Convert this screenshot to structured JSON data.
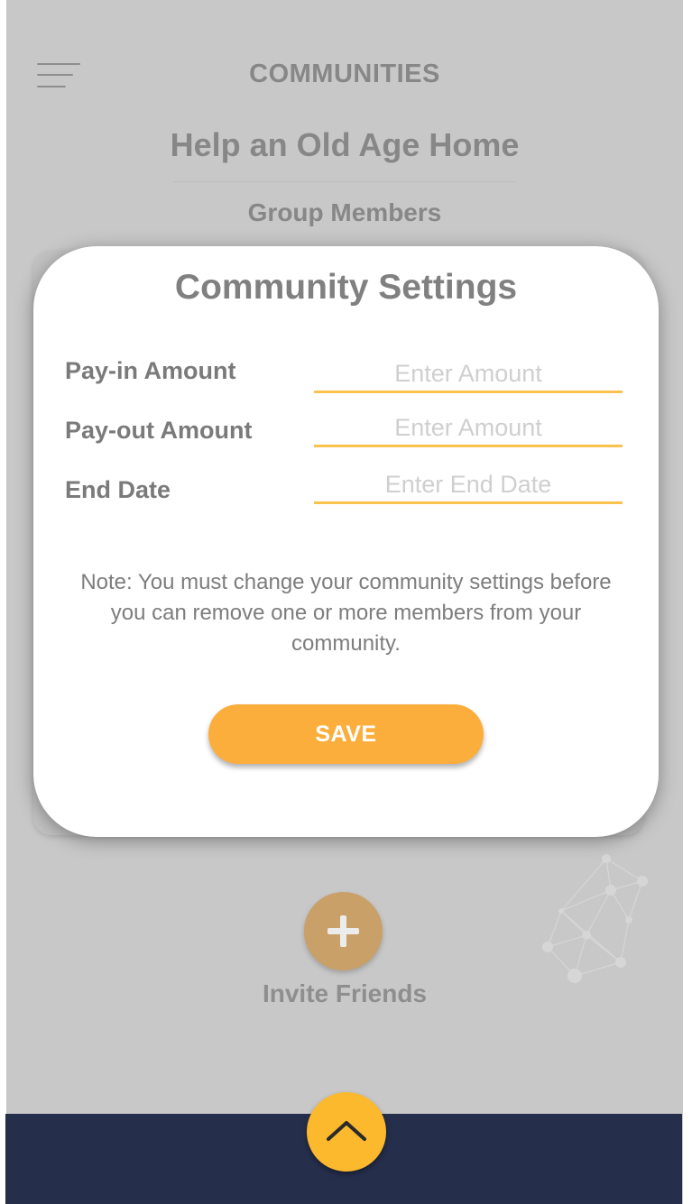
{
  "header": {
    "title": "COMMUNITIES",
    "community_name": "Help an Old Age Home",
    "section_label": "Group Members",
    "menu_icon": "hamburger-menu-icon"
  },
  "modal": {
    "title": "Community Settings",
    "fields": [
      {
        "label": "Pay-in Amount",
        "placeholder": "Enter Amount",
        "value": ""
      },
      {
        "label": "Pay-out Amount",
        "placeholder": "Enter Amount",
        "value": ""
      },
      {
        "label": "End Date",
        "placeholder": "Enter End Date",
        "value": ""
      }
    ],
    "note": "Note: You must change your community settings before you can remove one or more members from your community.",
    "save_label": "SAVE"
  },
  "invite": {
    "label": "Invite Friends",
    "icon": "plus-icon"
  },
  "bottom_nav": {
    "icon": "chevron-up-icon"
  },
  "colors": {
    "accent": "#fcb92d",
    "save_button": "#fcae3c",
    "input_underline": "#fcc24f",
    "bottom_bar": "#252e4b",
    "overlay_background": "#c8c8c8",
    "invite_button": "#c9a068"
  }
}
